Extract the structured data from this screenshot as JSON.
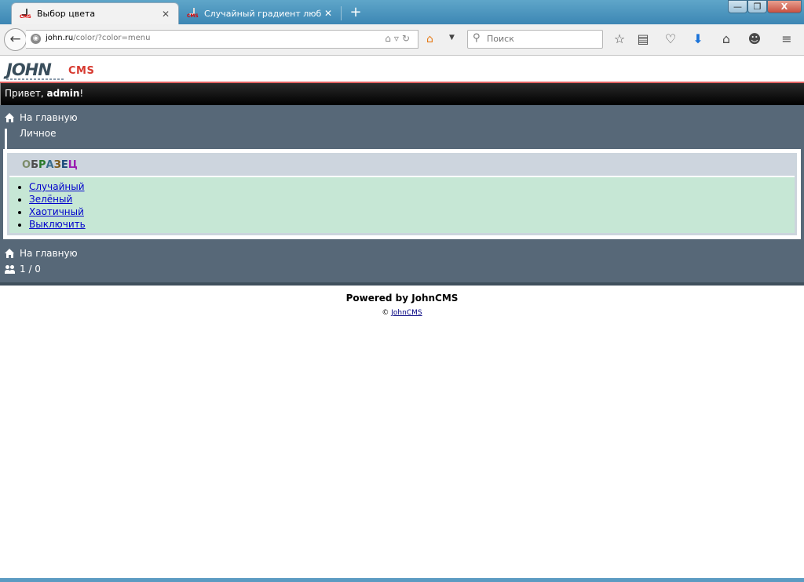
{
  "browser": {
    "tabs": [
      {
        "title": "Выбор цвета",
        "active": true
      },
      {
        "title": "Случайный градиент любог...",
        "active": false
      }
    ],
    "new_tab_symbol": "+",
    "window_buttons": {
      "minimize": "—",
      "maximize": "❐",
      "close": "X"
    },
    "url_host": "john.ru",
    "url_path": "/color/?color=menu",
    "search_placeholder": "Поиск"
  },
  "logo": {
    "john": "JOHN",
    "cms": "CMS"
  },
  "greeting": {
    "prefix": "Привет, ",
    "user": "admin",
    "suffix": "!"
  },
  "top_nav": [
    {
      "icon": "home-icon",
      "label": "На главную"
    },
    {
      "icon": "grid-icon",
      "label": "Личное"
    }
  ],
  "sample": {
    "letters": [
      {
        "ch": "О",
        "color": "#7d8c6a"
      },
      {
        "ch": "Б",
        "color": "#4d4d4d"
      },
      {
        "ch": "Р",
        "color": "#2a7a2a"
      },
      {
        "ch": "А",
        "color": "#3c6e8c"
      },
      {
        "ch": "З",
        "color": "#7a5a1a"
      },
      {
        "ch": "Е",
        "color": "#1a4a7a"
      },
      {
        "ch": "Ц",
        "color": "#9a1ab0"
      }
    ]
  },
  "options": [
    "Случайный",
    "Зелёный",
    "Хаотичный",
    "Выключить"
  ],
  "bottom_nav": [
    {
      "icon": "home-icon",
      "label": "На главную"
    },
    {
      "icon": "users-icon",
      "label": "1 / 0"
    }
  ],
  "footer": {
    "powered": "Powered by JohnCMS",
    "copy_symbol": "©",
    "copy_link": "JohnCMS"
  },
  "colors": {
    "panel": "#576878",
    "list_bg": "#c6e7d5",
    "header_bg": "#cdd5de",
    "link": "#0000cc"
  }
}
